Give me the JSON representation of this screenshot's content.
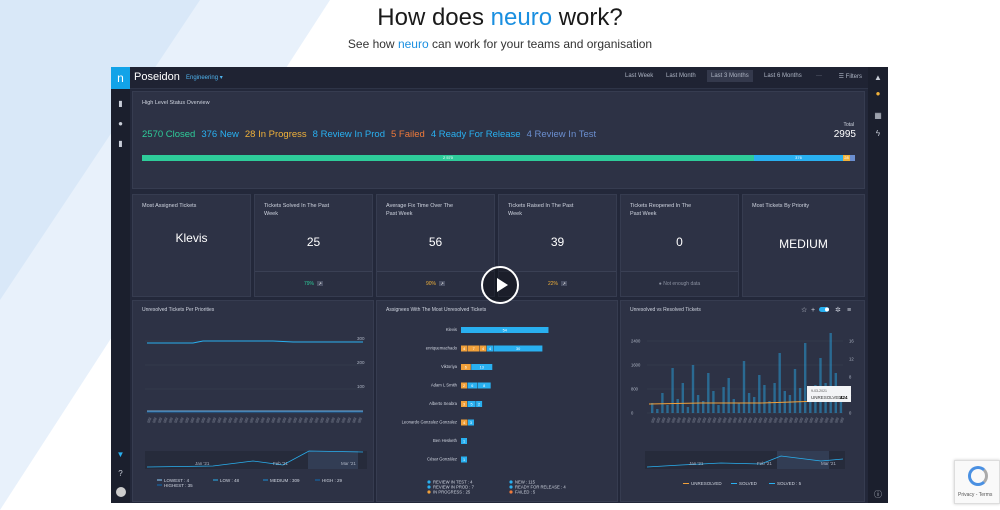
{
  "hero": {
    "title_pre": "How does ",
    "title_brand": "neuro",
    "title_post": " work?",
    "sub_pre": "See how ",
    "sub_brand": "neuro",
    "sub_post": " can work for your teams and organisation"
  },
  "app": {
    "logo": "n",
    "name": "Poseidon",
    "team": "Engineering ▾",
    "ranges": [
      "Last Week",
      "Last Month",
      "Last 3 Months",
      "Last 6 Months"
    ],
    "active_range": "Last 3 Months",
    "more": "···",
    "filters": "Filters"
  },
  "overview": {
    "title": "High Level Status Overview",
    "statuses": [
      {
        "label": "2570 Closed",
        "color": "#2ecc9a"
      },
      {
        "label": "376 New",
        "color": "#29b0f0"
      },
      {
        "label": "28 In Progress",
        "color": "#f0b13a"
      },
      {
        "label": "8 Review In Prod",
        "color": "#29b0f0"
      },
      {
        "label": "5 Failed",
        "color": "#f07a3a"
      },
      {
        "label": "4 Ready For Release",
        "color": "#29b0f0"
      },
      {
        "label": "4 Review In Test",
        "color": "#6b8fd0"
      }
    ],
    "total_label": "Total",
    "total_value": "2995",
    "bar_closed": "2 570",
    "bar_new": "376",
    "bar_prog": "28"
  },
  "kpis": [
    {
      "title": "Most Assigned Tickets",
      "value": "Klevis",
      "pct": "",
      "pct_color": ""
    },
    {
      "title": "Tickets Solved In The Past Week",
      "value": "25",
      "pct": "79%",
      "pct_color": "#2ecc9a"
    },
    {
      "title": "Average Fix Time Over The Past Week",
      "value": "56",
      "pct": "90%",
      "pct_color": "#f0b13a"
    },
    {
      "title": "Tickets Raised In The Past Week",
      "value": "39",
      "pct": "22%",
      "pct_color": "#f0b13a"
    },
    {
      "title": "Tickets Reopened In The Past Week",
      "value": "0",
      "pct": "Not enough data",
      "pct_color": "#8a90a0"
    },
    {
      "title": "Most Tickets By Priority",
      "value": "MEDIUM",
      "pct": "",
      "pct_color": ""
    }
  ],
  "colors": {
    "lowest": "#8fd3ff",
    "low": "#29b0f0",
    "medium": "#1a8fd8",
    "high": "#0f6fb8",
    "orange": "#f0a03a"
  },
  "charts": {
    "priorities": {
      "title": "Unresolved Tickets Per Priorities",
      "y_ticks": [
        "300",
        "200",
        "100"
      ],
      "nav_dates": [
        "Jan '21",
        "Feb '21",
        "Mar '21"
      ],
      "legend": [
        "LOWEST : 4",
        "HIGHEST : 35",
        "LOW : 48",
        "MEDIUM : 309",
        "HIGH : 29"
      ]
    },
    "assignees": {
      "title": "Assignees With The Most Unresolved Tickets",
      "rows": [
        {
          "name": "Klevis",
          "segments": [
            {
              "v": 54,
              "c": "#29b0f0"
            }
          ]
        },
        {
          "name": "enriquemachado",
          "segments": [
            {
              "v": 4,
              "c": "#f0a03a"
            },
            {
              "v": 7,
              "c": "#f0a03a"
            },
            {
              "v": 4,
              "c": "#f0a03a"
            },
            {
              "v": 4,
              "c": "#29b0f0"
            },
            {
              "v": 30,
              "c": "#29b0f0"
            }
          ]
        },
        {
          "name": "Viktoriya",
          "segments": [
            {
              "v": 6,
              "c": "#f0a03a"
            },
            {
              "v": 13,
              "c": "#29b0f0"
            }
          ]
        },
        {
          "name": "Adam L Smith",
          "segments": [
            {
              "v": 2,
              "c": "#f0a03a"
            },
            {
              "v": 6,
              "c": "#29b0f0"
            },
            {
              "v": 8,
              "c": "#29b0f0"
            }
          ]
        },
        {
          "name": "Alberto Seabra",
          "segments": [
            {
              "v": 3,
              "c": "#f0a03a"
            },
            {
              "v": 5,
              "c": "#29b0f0"
            },
            {
              "v": 2,
              "c": "#29b0f0"
            }
          ]
        },
        {
          "name": "Leonardo Gonzalez Gonzalez",
          "segments": [
            {
              "v": 4,
              "c": "#f0a03a"
            },
            {
              "v": 3,
              "c": "#29b0f0"
            }
          ]
        },
        {
          "name": "Ben Hesketh",
          "segments": [
            {
              "v": 1,
              "c": "#29b0f0"
            }
          ]
        },
        {
          "name": "César González",
          "segments": [
            {
              "v": 1,
              "c": "#29b0f0"
            }
          ]
        }
      ],
      "legend_left": [
        "REVIEW IN TEST : 4",
        "REVIEW IN PROD : 7",
        "IN PROGRESS : 25"
      ],
      "legend_right": [
        "NEW : 115",
        "READY FOR RELEASE : 4",
        "FAILED : 5"
      ]
    },
    "resolved": {
      "title": "Unresolved vs Resolved Tickets",
      "y_left": [
        "2400",
        "1600",
        "800",
        "0"
      ],
      "y_right": [
        "16",
        "12",
        "8",
        "4",
        "0"
      ],
      "tooltip_date": "9-03-2021",
      "tooltip_label": "UNRESOLVED:",
      "tooltip_value": "424",
      "nav_dates": [
        "Jan '21",
        "Feb '21",
        "Mar '21"
      ],
      "legend": [
        "UNRESOLVED",
        "SOLVED",
        "SOLVED : 5"
      ]
    }
  },
  "recaptcha": {
    "text": "Privacy - Terms"
  }
}
